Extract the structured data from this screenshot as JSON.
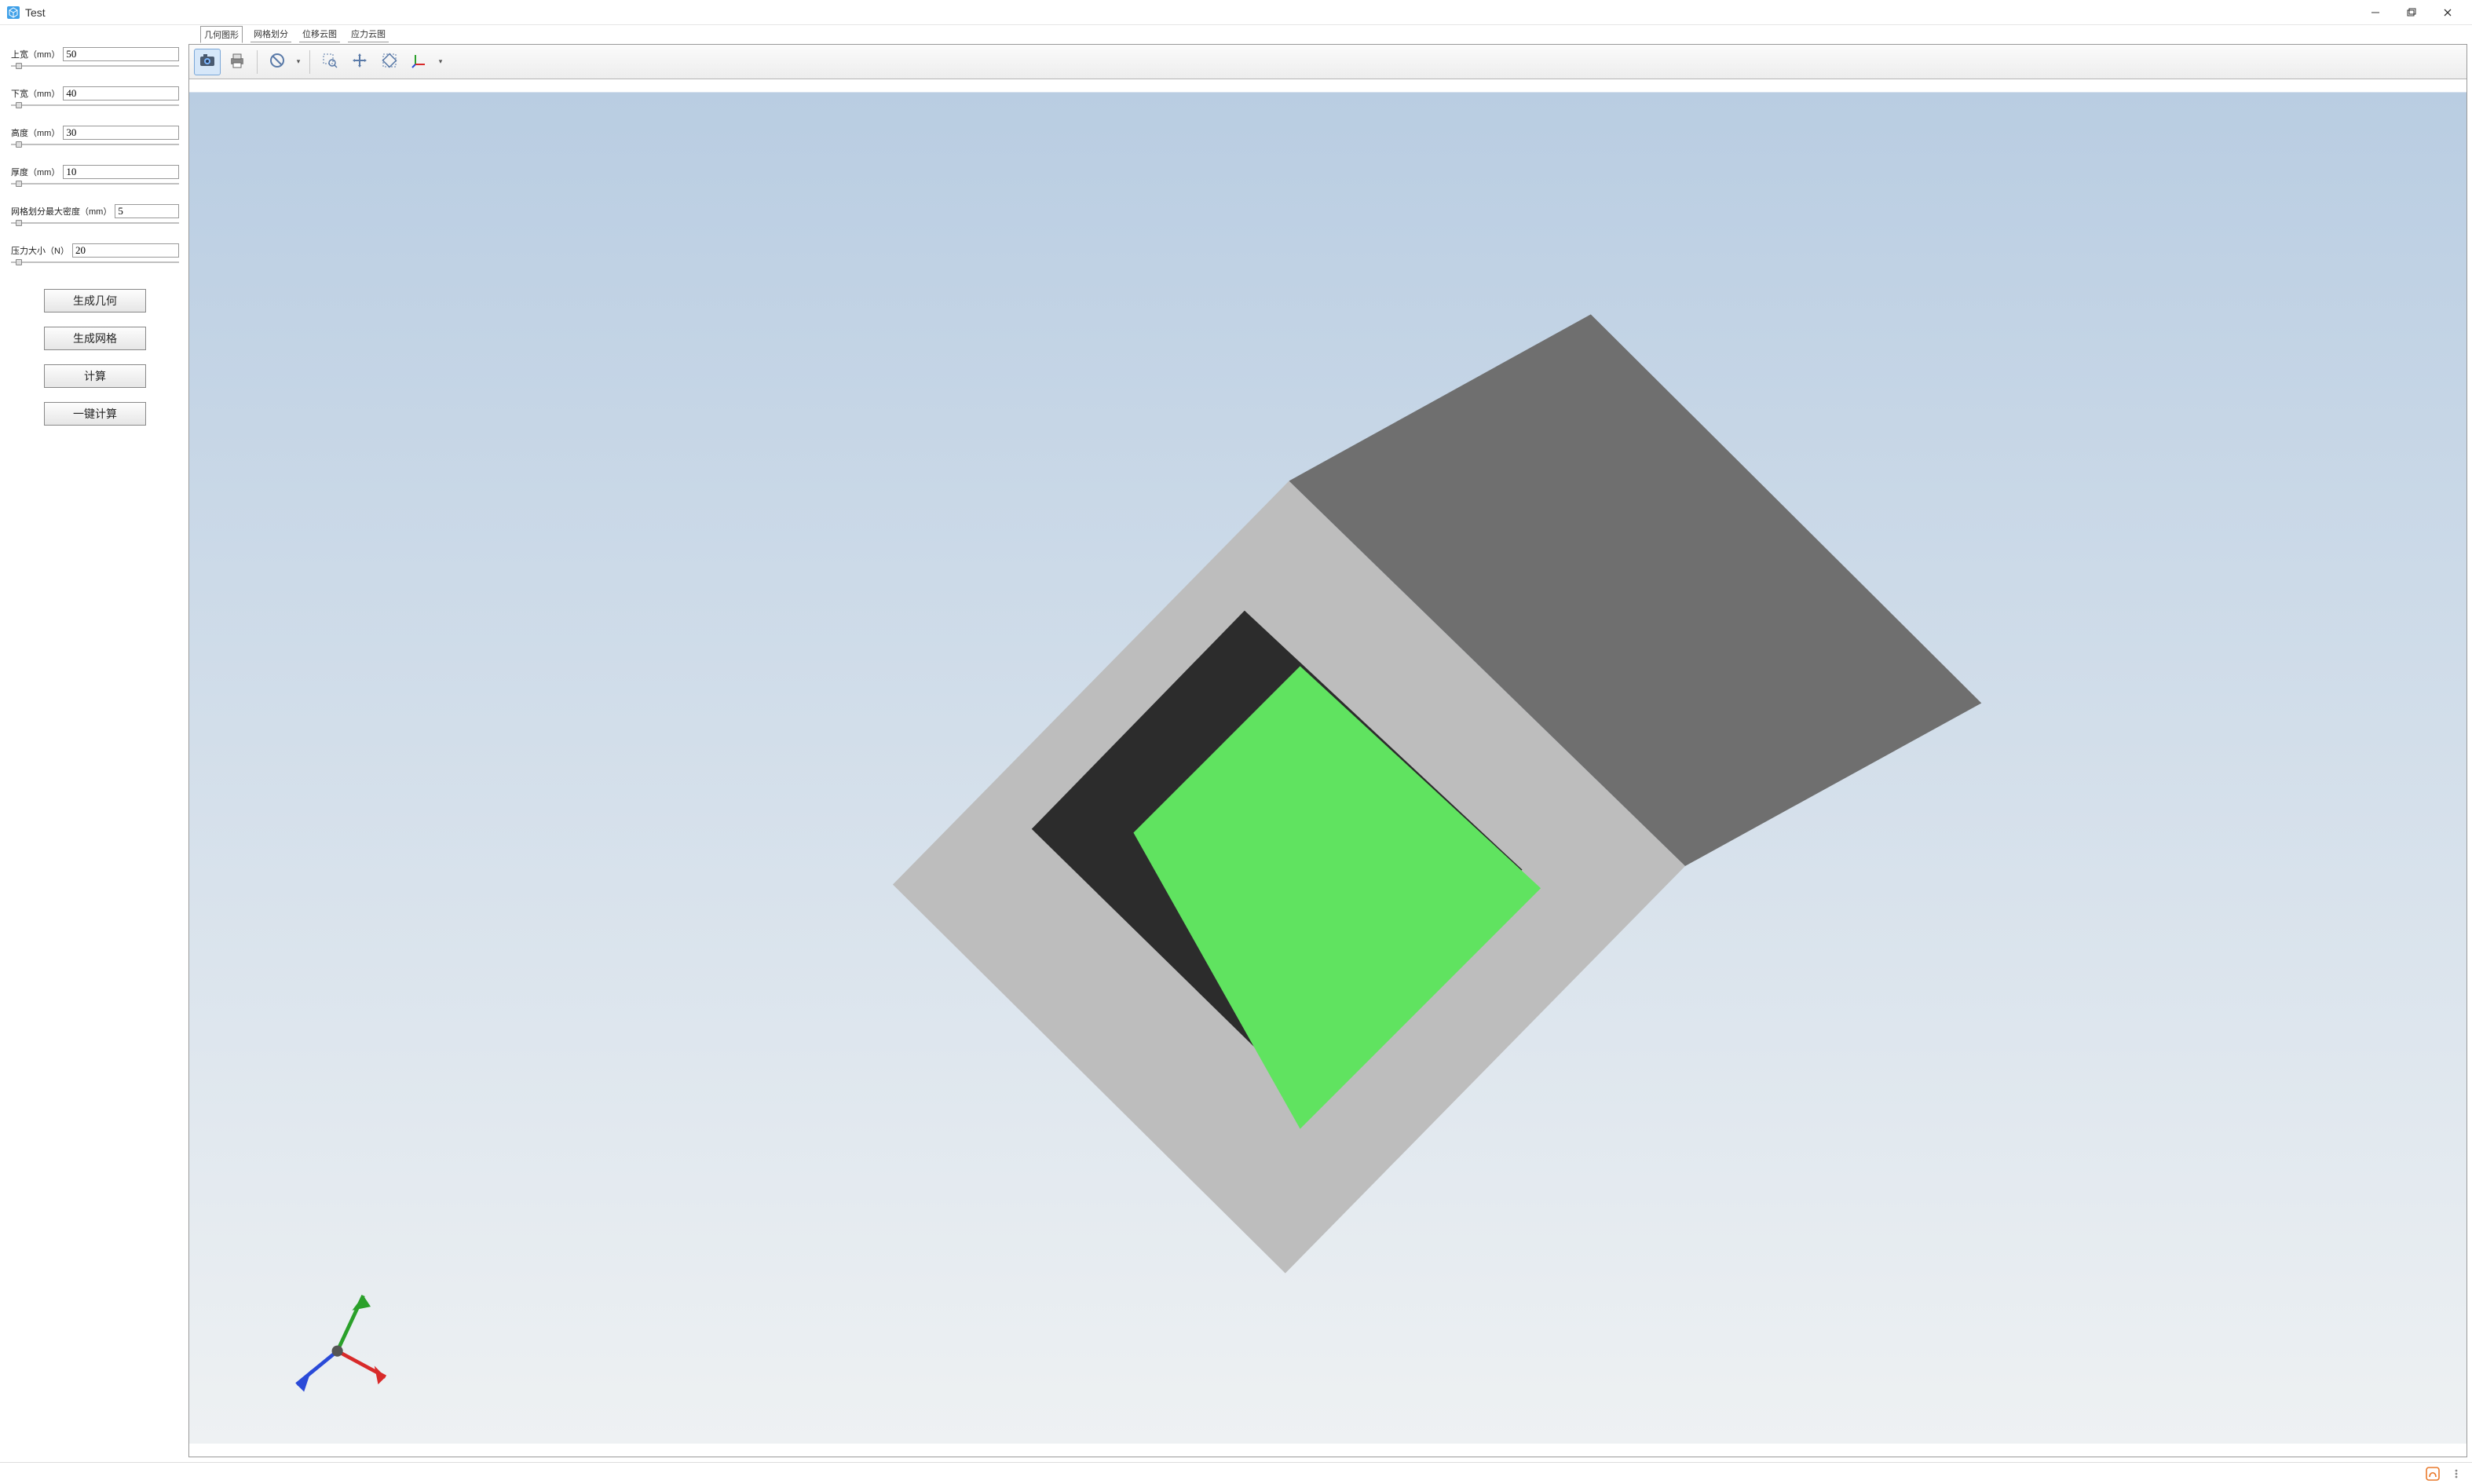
{
  "app": {
    "title": "Test"
  },
  "tabs": [
    {
      "label": "几何图形",
      "active": true
    },
    {
      "label": "网格划分",
      "active": false
    },
    {
      "label": "位移云图",
      "active": false
    },
    {
      "label": "应力云图",
      "active": false
    }
  ],
  "params": [
    {
      "label": "上宽（mm）",
      "value": "50",
      "thumb_pct": 3
    },
    {
      "label": "下宽（mm）",
      "value": "40",
      "thumb_pct": 3
    },
    {
      "label": "高度（mm）",
      "value": "30",
      "thumb_pct": 3
    },
    {
      "label": "厚度（mm）",
      "value": "10",
      "thumb_pct": 3
    },
    {
      "label": "网格划分最大密度（mm）",
      "value": "5",
      "thumb_pct": 3
    },
    {
      "label": "压力大小（N）",
      "value": "20",
      "thumb_pct": 3
    }
  ],
  "buttons": {
    "gen_geom": "生成几何",
    "gen_mesh": "生成网格",
    "calc": "计算",
    "one_key": "一键计算"
  },
  "toolbar": {
    "items": [
      {
        "name": "camera-icon",
        "active": true,
        "dropdown": false
      },
      {
        "name": "print-icon",
        "active": false,
        "dropdown": false
      },
      {
        "name": "sep"
      },
      {
        "name": "no-entry-icon",
        "active": false,
        "dropdown": true
      },
      {
        "name": "sep"
      },
      {
        "name": "zoom-region-icon",
        "active": false,
        "dropdown": false
      },
      {
        "name": "pan-icon",
        "active": false,
        "dropdown": false
      },
      {
        "name": "fit-view-icon",
        "active": false,
        "dropdown": false
      },
      {
        "name": "axes-icon",
        "active": false,
        "dropdown": true
      }
    ]
  },
  "viewport": {
    "background_top": "#b9cde2",
    "background_bottom": "#eef1f3",
    "model": {
      "face_front": "#bdbdbd",
      "face_top": "#6f6f6f",
      "face_inner_dark": "#2c2c2c",
      "face_highlight": "#60e360"
    },
    "triad": {
      "x": "#d82a2a",
      "y": "#2aa02a",
      "z": "#2a4ad8"
    }
  }
}
